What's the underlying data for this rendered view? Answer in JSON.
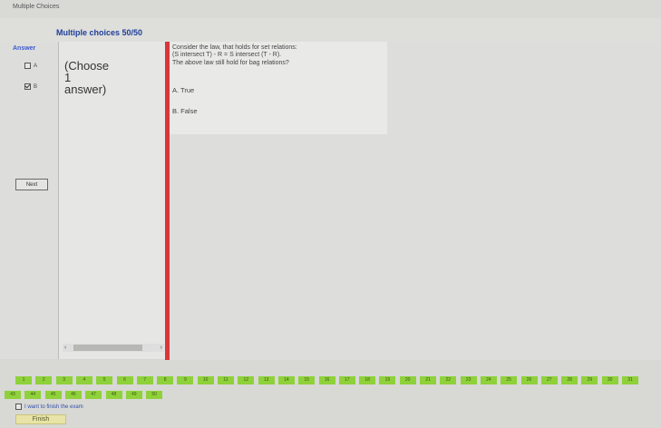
{
  "window": {
    "title": "Multiple Choices"
  },
  "header": {
    "title": "Multiple choices 50/50"
  },
  "answer_panel": {
    "title": "Answer",
    "options": [
      {
        "label": "A",
        "checked": false
      },
      {
        "label": "B",
        "checked": true
      }
    ],
    "next_label": "Next"
  },
  "instruction": {
    "line1": "(Choose",
    "line2": "1",
    "line3": "answer)"
  },
  "question": {
    "lines": [
      "Consider the law, that holds for set relations:",
      "(S intersect T) - R = S intersect (T - R).",
      "The above law still hold for bag relations?"
    ],
    "choices": [
      "A. True",
      "B. False"
    ]
  },
  "navigator": {
    "questions": [
      "1",
      "2",
      "3",
      "4",
      "5",
      "6",
      "7",
      "8",
      "9",
      "10",
      "11",
      "12",
      "13",
      "14",
      "15",
      "16",
      "17",
      "18",
      "19",
      "20",
      "21",
      "22",
      "23",
      "24",
      "25",
      "26",
      "27",
      "28",
      "29",
      "30",
      "31",
      "43",
      "44",
      "45",
      "46",
      "47",
      "48",
      "49",
      "50"
    ]
  },
  "finish": {
    "checkbox_label": "I want to finish the exam",
    "button_label": "Finish"
  }
}
